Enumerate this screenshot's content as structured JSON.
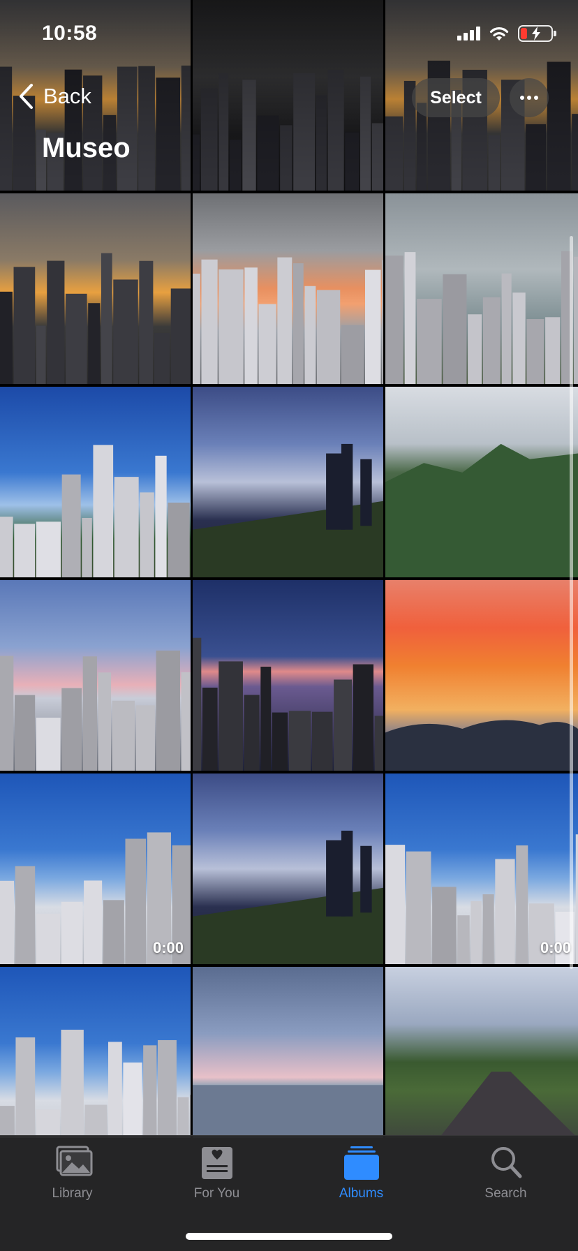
{
  "status_bar": {
    "time": "10:58"
  },
  "nav": {
    "back_label": "Back",
    "title": "Museo",
    "select_label": "Select"
  },
  "photos": [
    {
      "scene": "city-sunset"
    },
    {
      "scene": "night-tower"
    },
    {
      "scene": "city-sunset"
    },
    {
      "scene": "city-sunset"
    },
    {
      "scene": "orange-clouds"
    },
    {
      "scene": "construction-rainbow"
    },
    {
      "scene": "construction-blue"
    },
    {
      "scene": "palms-dusk"
    },
    {
      "scene": "mountains"
    },
    {
      "scene": "city-morning"
    },
    {
      "scene": "city-dusk"
    },
    {
      "scene": "red-sky"
    },
    {
      "scene": "city-blue",
      "duration": "0:00"
    },
    {
      "scene": "palms-dusk"
    },
    {
      "scene": "city-blue",
      "duration": "0:00"
    },
    {
      "scene": "city-blue"
    },
    {
      "scene": "sea"
    },
    {
      "scene": "road"
    }
  ],
  "tab_bar": {
    "library": "Library",
    "for_you": "For You",
    "albums": "Albums",
    "search": "Search",
    "active": "albums",
    "active_color": "#2f8cff",
    "inactive_color": "#8e8e93"
  }
}
